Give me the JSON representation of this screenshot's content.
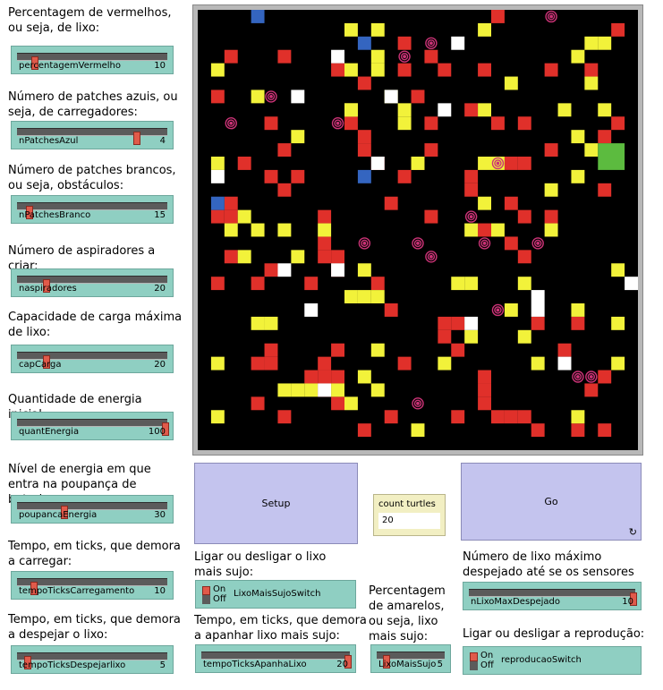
{
  "sliders": [
    {
      "note": "Percentagem de vermelhos, ou seja, de lixo:",
      "label": "percentagemVermelho",
      "value": "10",
      "level": 0.1
    },
    {
      "note": "Número de patches azuis, ou seja, de carregadores:",
      "label": "nPatchesAzul",
      "value": "4",
      "level": 0.8
    },
    {
      "note": "Número de patches brancos, ou seja, obstáculos:",
      "label": "nPatchesBranco",
      "value": "15",
      "level": 0.06
    },
    {
      "note": "Número de aspiradores a criar:",
      "label": "naspiradores",
      "value": "20",
      "level": 0.18
    },
    {
      "note": "Capacidade de carga máxima de lixo:",
      "label": "capCarga",
      "value": "20",
      "level": 0.18
    },
    {
      "note": "Quantidade de energia inicial:",
      "label": "quantEnergia",
      "value": "100",
      "level": 1.0
    },
    {
      "note": "Nível de energia em que entra na poupança de bateria:",
      "label": "poupancaEnergia",
      "value": "30",
      "level": 0.3
    },
    {
      "note": "Tempo, em ticks, que demora a carregar:",
      "label": "tempoTicksCarregamento",
      "value": "10",
      "level": 0.09
    },
    {
      "note": "Tempo, em ticks, que demora a despejar o lixo:",
      "label": "tempoTicksDespejarlixo",
      "value": "5",
      "level": 0.05
    }
  ],
  "buttons": {
    "setup": "Setup",
    "go": "Go"
  },
  "monitor": {
    "label": "count turtles",
    "value": "20"
  },
  "notes": {
    "lixo_switch": "Ligar ou desligar o lixo mais sujo:",
    "apanhar": "Tempo, em ticks, que demora a apanhar lixo mais sujo:",
    "amarelos": "Percentagem de amarelos, ou seja, lixo mais sujo:",
    "nlixo": "Número de lixo máximo despejado até se os sensores se estragarem:",
    "reproducao": "Ligar ou desligar a reprodução:"
  },
  "switches": {
    "on": "On",
    "off": "Off",
    "lixo": "LixoMaisSujoSwitch",
    "reproducao": "reproducaoSwitch"
  },
  "bottom_sliders": {
    "apanhar": {
      "label": "tempoTicksApanhaLixo",
      "value": "20",
      "level": 1.0
    },
    "lixoMaisSujo": {
      "label": "LixoMaisSujo",
      "value": "5",
      "level": 0.1
    },
    "nlixo": {
      "label": "nLixoMaxDespejado",
      "value": "10",
      "level": 1.0
    }
  },
  "colors": {
    "red": "#e0302a",
    "yellow": "#f2f23a",
    "white": "#ffffff",
    "blue": "#3465c0",
    "green": "#5cbb3f",
    "turtle": "#cc3377"
  },
  "world": {
    "grid_size": 33,
    "red": [
      [
        22,
        0
      ],
      [
        15,
        2
      ],
      [
        31,
        1
      ],
      [
        17,
        3
      ],
      [
        2,
        3
      ],
      [
        6,
        3
      ],
      [
        15,
        4
      ],
      [
        18,
        4
      ],
      [
        21,
        4
      ],
      [
        26,
        4
      ],
      [
        29,
        4
      ],
      [
        10,
        4
      ],
      [
        12,
        5
      ],
      [
        16,
        6
      ],
      [
        1,
        6
      ],
      [
        20,
        7
      ],
      [
        5,
        8
      ],
      [
        11,
        8
      ],
      [
        12,
        9
      ],
      [
        17,
        8
      ],
      [
        22,
        8
      ],
      [
        24,
        8
      ],
      [
        31,
        8
      ],
      [
        12,
        10
      ],
      [
        17,
        10
      ],
      [
        26,
        10
      ],
      [
        30,
        9
      ],
      [
        6,
        10
      ],
      [
        20,
        12
      ],
      [
        23,
        11
      ],
      [
        24,
        11
      ],
      [
        13,
        11
      ],
      [
        3,
        11
      ],
      [
        7,
        12
      ],
      [
        16,
        11
      ],
      [
        5,
        12
      ],
      [
        15,
        12
      ],
      [
        20,
        13
      ],
      [
        30,
        13
      ],
      [
        6,
        13
      ],
      [
        23,
        14
      ],
      [
        2,
        14
      ],
      [
        14,
        14
      ],
      [
        1,
        15
      ],
      [
        2,
        15
      ],
      [
        26,
        15
      ],
      [
        9,
        15
      ],
      [
        17,
        15
      ],
      [
        24,
        15
      ],
      [
        21,
        16
      ],
      [
        23,
        17
      ],
      [
        2,
        18
      ],
      [
        9,
        17
      ],
      [
        9,
        18
      ],
      [
        10,
        18
      ],
      [
        10,
        19
      ],
      [
        5,
        19
      ],
      [
        24,
        18
      ],
      [
        8,
        20
      ],
      [
        13,
        20
      ],
      [
        1,
        20
      ],
      [
        4,
        20
      ],
      [
        14,
        22
      ],
      [
        25,
        23
      ],
      [
        18,
        23
      ],
      [
        19,
        23
      ],
      [
        28,
        23
      ],
      [
        18,
        24
      ],
      [
        5,
        25
      ],
      [
        10,
        25
      ],
      [
        19,
        25
      ],
      [
        27,
        25
      ],
      [
        15,
        26
      ],
      [
        30,
        27
      ],
      [
        4,
        26
      ],
      [
        5,
        26
      ],
      [
        9,
        26
      ],
      [
        8,
        27
      ],
      [
        9,
        27
      ],
      [
        21,
        27
      ],
      [
        21,
        28
      ],
      [
        10,
        27
      ],
      [
        29,
        28
      ],
      [
        9,
        28
      ],
      [
        10,
        29
      ],
      [
        4,
        29
      ],
      [
        21,
        29
      ],
      [
        6,
        30
      ],
      [
        12,
        31
      ],
      [
        25,
        31
      ],
      [
        28,
        31
      ],
      [
        30,
        31
      ],
      [
        24,
        30
      ],
      [
        14,
        30
      ],
      [
        19,
        30
      ],
      [
        22,
        30
      ],
      [
        23,
        30
      ]
    ],
    "yellow": [
      [
        11,
        1
      ],
      [
        13,
        1
      ],
      [
        21,
        1
      ],
      [
        29,
        2
      ],
      [
        30,
        2
      ],
      [
        1,
        4
      ],
      [
        28,
        3
      ],
      [
        11,
        4
      ],
      [
        13,
        4
      ],
      [
        13,
        3
      ],
      [
        23,
        5
      ],
      [
        29,
        5
      ],
      [
        4,
        6
      ],
      [
        14,
        6
      ],
      [
        11,
        7
      ],
      [
        21,
        7
      ],
      [
        15,
        7
      ],
      [
        15,
        8
      ],
      [
        30,
        7
      ],
      [
        27,
        7
      ],
      [
        11,
        7
      ],
      [
        28,
        9
      ],
      [
        7,
        9
      ],
      [
        16,
        11
      ],
      [
        29,
        10
      ],
      [
        1,
        11
      ],
      [
        21,
        11
      ],
      [
        22,
        11
      ],
      [
        26,
        13
      ],
      [
        28,
        12
      ],
      [
        21,
        14
      ],
      [
        3,
        15
      ],
      [
        4,
        16
      ],
      [
        6,
        16
      ],
      [
        2,
        16
      ],
      [
        9,
        16
      ],
      [
        20,
        16
      ],
      [
        22,
        16
      ],
      [
        26,
        16
      ],
      [
        7,
        18
      ],
      [
        3,
        18
      ],
      [
        12,
        19
      ],
      [
        19,
        20
      ],
      [
        20,
        20
      ],
      [
        24,
        20
      ],
      [
        11,
        21
      ],
      [
        12,
        21
      ],
      [
        13,
        21
      ],
      [
        31,
        19
      ],
      [
        23,
        22
      ],
      [
        28,
        22
      ],
      [
        31,
        23
      ],
      [
        4,
        23
      ],
      [
        5,
        23
      ],
      [
        24,
        24
      ],
      [
        20,
        24
      ],
      [
        31,
        26
      ],
      [
        1,
        26
      ],
      [
        13,
        25
      ],
      [
        18,
        26
      ],
      [
        25,
        26
      ],
      [
        12,
        27
      ],
      [
        13,
        28
      ],
      [
        6,
        28
      ],
      [
        7,
        28
      ],
      [
        8,
        28
      ],
      [
        10,
        28
      ],
      [
        11,
        29
      ],
      [
        28,
        30
      ],
      [
        1,
        30
      ],
      [
        16,
        31
      ]
    ],
    "white": [
      [
        19,
        2
      ],
      [
        10,
        3
      ],
      [
        14,
        6
      ],
      [
        7,
        6
      ],
      [
        18,
        7
      ],
      [
        1,
        12
      ],
      [
        13,
        11
      ],
      [
        6,
        19
      ],
      [
        10,
        19
      ],
      [
        8,
        22
      ],
      [
        32,
        20
      ],
      [
        25,
        21
      ],
      [
        20,
        23
      ],
      [
        25,
        22
      ],
      [
        27,
        26
      ],
      [
        9,
        28
      ]
    ],
    "blue": [
      [
        4,
        0
      ],
      [
        12,
        2
      ],
      [
        12,
        12
      ],
      [
        1,
        14
      ]
    ],
    "green": [
      [
        30,
        10
      ]
    ],
    "turtles": [
      [
        26,
        0
      ],
      [
        17,
        2
      ],
      [
        15,
        3
      ],
      [
        5,
        6
      ],
      [
        2,
        8
      ],
      [
        10,
        8
      ],
      [
        22,
        11
      ],
      [
        20,
        15
      ],
      [
        12,
        17
      ],
      [
        16,
        17
      ],
      [
        21,
        17
      ],
      [
        25,
        17
      ],
      [
        17,
        18
      ],
      [
        22,
        22
      ],
      [
        28,
        27
      ],
      [
        29,
        27
      ],
      [
        16,
        29
      ]
    ]
  }
}
